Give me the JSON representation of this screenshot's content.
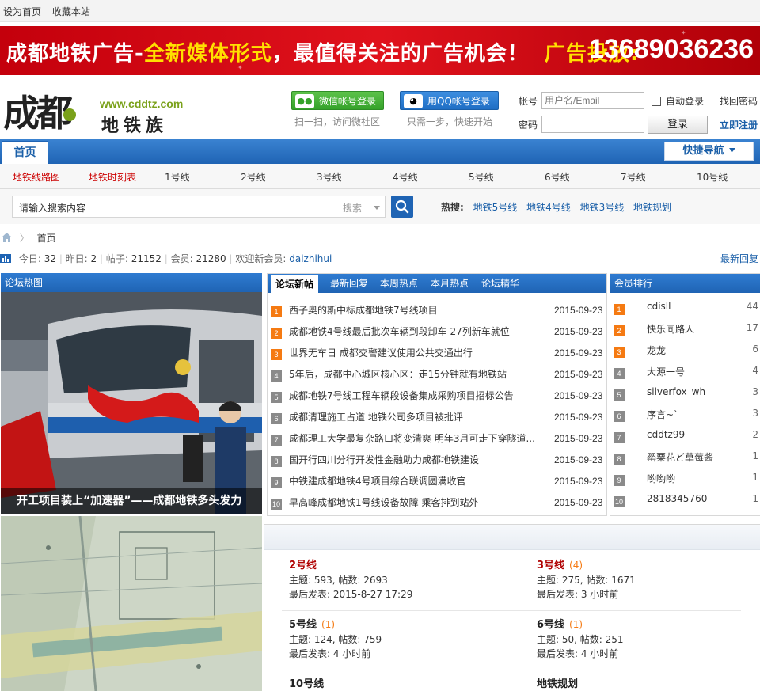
{
  "topbar": {
    "set_home": "设为首页",
    "bookmark": "收藏本站"
  },
  "banner": {
    "part1": "成都地铁广告-",
    "part2": "全新媒体形式",
    "part3": "，最值得关注的广告机会",
    "part4": "！",
    "ad_label": "广告投放:",
    "phone": "13689036236"
  },
  "logo": {
    "chars": "成都",
    "url": "www.cddtz.com",
    "name": "地铁族"
  },
  "social": {
    "wechat_label": "微信帐号登录",
    "wechat_sub": "扫一扫，访问微社区",
    "qq_label": "用QQ帐号登录",
    "qq_sub": "只需一步，快速开始"
  },
  "login": {
    "account_label": "帐号",
    "account_placeholder": "用户名/Email",
    "password_label": "密码",
    "auto_login": "自动登录",
    "login_button": "登录",
    "find_password": "找回密码",
    "register": "立即注册"
  },
  "nav": {
    "home": "首页",
    "quick_nav": "快捷导航"
  },
  "subnav": {
    "items": [
      "地铁线路图",
      "地铁时刻表",
      "1号线",
      "2号线",
      "3号线",
      "4号线",
      "5号线",
      "6号线",
      "7号线",
      "10号线"
    ]
  },
  "search": {
    "placeholder": "请输入搜索内容",
    "select_label": "搜索",
    "hot_label": "热搜:",
    "hot": [
      "地铁5号线",
      "地铁4号线",
      "地铁3号线",
      "地铁规划"
    ]
  },
  "breadcrumb": {
    "home": "首页"
  },
  "stats": {
    "today_label": "今日:",
    "today": "32",
    "yesterday_label": "昨日:",
    "yesterday": "2",
    "posts_label": "帖子:",
    "posts": "21152",
    "members_label": "会员:",
    "members": "21280",
    "welcome_label": "欢迎新会员:",
    "new_member": "daizhihui",
    "latest_replies": "最新回复"
  },
  "hot_panel": {
    "title": "论坛热图",
    "caption": "开工项目装上“加速器”——成都地铁多头发力"
  },
  "posts_panel": {
    "tabs": [
      "论坛新帖",
      "最新回复",
      "本周热点",
      "本月热点",
      "论坛精华"
    ],
    "items": [
      {
        "rank": "1",
        "title": "西子奥的斯中标成都地铁7号线项目",
        "date": "2015-09-23"
      },
      {
        "rank": "2",
        "title": "成都地铁4号线最后批次车辆到段卸车  27列新车就位",
        "date": "2015-09-23"
      },
      {
        "rank": "3",
        "title": "世界无车日  成都交警建议使用公共交通出行",
        "date": "2015-09-23"
      },
      {
        "rank": "4",
        "title": "5年后，成都中心城区核心区：走15分钟就有地铁站",
        "date": "2015-09-23"
      },
      {
        "rank": "5",
        "title": "成都地铁7号线工程车辆段设备集成采购项目招标公告",
        "date": "2015-09-23"
      },
      {
        "rank": "6",
        "title": "成都清理施工占道  地铁公司多项目被批评",
        "date": "2015-09-23"
      },
      {
        "rank": "7",
        "title": "成都理工大学最复杂路口将变清爽  明年3月可走下穿隧道...",
        "date": "2015-09-23"
      },
      {
        "rank": "8",
        "title": "国开行四川分行开发性金融助力成都地铁建设",
        "date": "2015-09-23"
      },
      {
        "rank": "9",
        "title": "中铁建成都地铁4号项目综合联调圆满收官",
        "date": "2015-09-23"
      },
      {
        "rank": "10",
        "title": "早高峰成都地铁1号线设备故障  乘客排到站外",
        "date": "2015-09-23"
      }
    ]
  },
  "members_panel": {
    "title": "会员排行",
    "items": [
      {
        "rank": "1",
        "name": "cdisll",
        "count": "44"
      },
      {
        "rank": "2",
        "name": "快乐同路人",
        "count": "17"
      },
      {
        "rank": "3",
        "name": "龙龙",
        "count": "6"
      },
      {
        "rank": "4",
        "name": "大源一号",
        "count": "4"
      },
      {
        "rank": "5",
        "name": "silverfox_wh",
        "count": "3"
      },
      {
        "rank": "6",
        "name": "序言~`",
        "count": "3"
      },
      {
        "rank": "7",
        "name": "cddtz99",
        "count": "2"
      },
      {
        "rank": "8",
        "name": "罂粟花ど草莓酱",
        "count": "1"
      },
      {
        "rank": "9",
        "name": "哟哟哟",
        "count": "1"
      },
      {
        "rank": "10",
        "name": "2818345760",
        "count": "1"
      }
    ]
  },
  "forums": [
    {
      "name": "2号线",
      "new": "",
      "stats": "主题: 593, 帖数: 2693",
      "last": "最后发表: 2015-8-27 17:29"
    },
    {
      "name": "3号线",
      "new": "(4)",
      "stats": "主题: 275, 帖数: 1671",
      "last": "最后发表: 3 小时前"
    },
    {
      "name": "5号线",
      "new": "(1)",
      "stats": "主题: 124, 帖数: 759",
      "last": "最后发表: 4 小时前"
    },
    {
      "name": "6号线",
      "new": "(1)",
      "stats": "主题: 50, 帖数: 251",
      "last": "最后发表: 4 小时前"
    },
    {
      "name": "10号线",
      "new": "",
      "stats": "",
      "last": ""
    },
    {
      "name": "地铁规划",
      "new": "",
      "stats": "",
      "last": ""
    }
  ],
  "colors": {
    "brand_blue": "#1f64b4",
    "banner_red": "#e0121c",
    "rank_orange": "#f57a12"
  }
}
